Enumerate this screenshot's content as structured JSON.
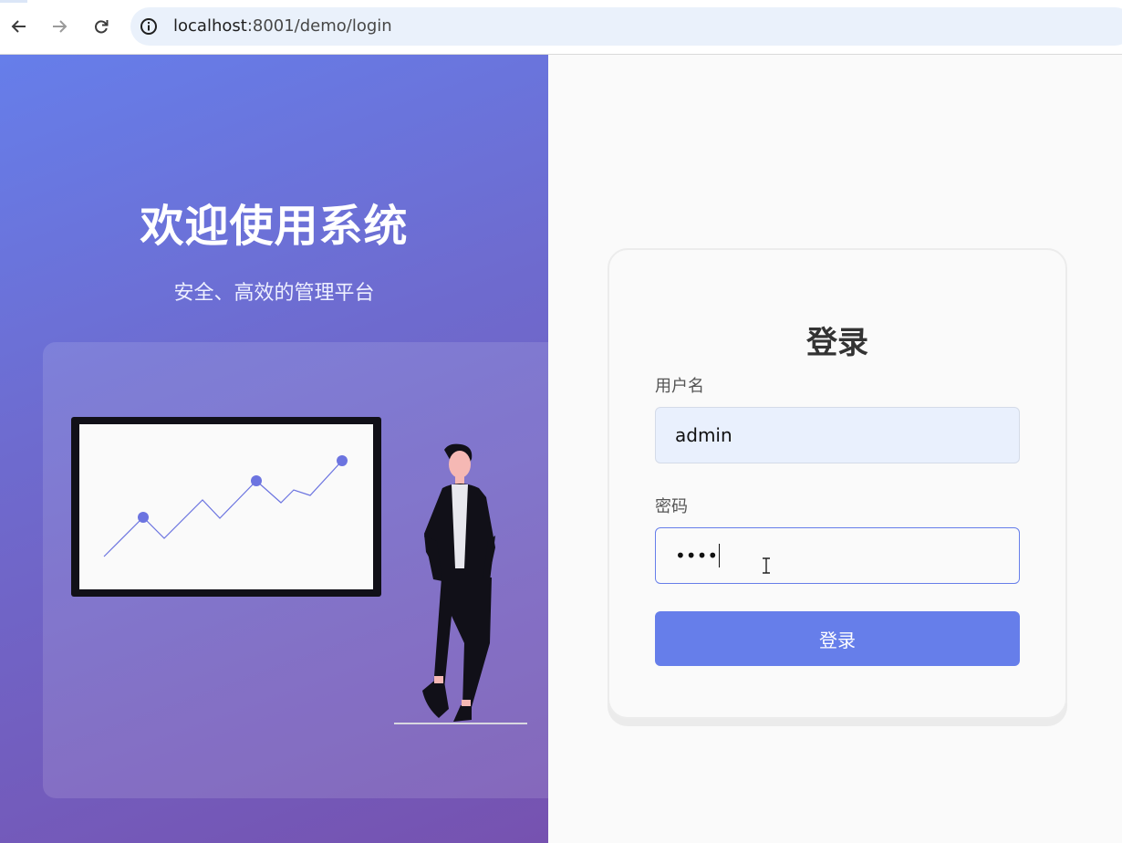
{
  "browser": {
    "url_host": "localhost",
    "url_rest": ":8001/demo/login"
  },
  "hero": {
    "title": "欢迎使用系统",
    "subtitle": "安全、高效的管理平台"
  },
  "login": {
    "title": "登录",
    "username_label": "用户名",
    "username_value": "admin",
    "password_label": "密码",
    "password_masked": "••••",
    "submit_label": "登录"
  },
  "colors": {
    "accent": "#667eea",
    "hero_gradient_end": "#7652b0"
  }
}
